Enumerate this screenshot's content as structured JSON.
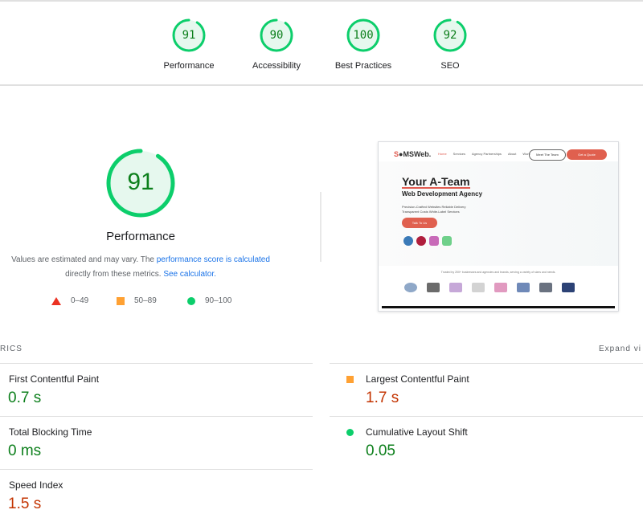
{
  "summary_gauges": [
    {
      "label": "Performance",
      "score": 91,
      "status": "pass"
    },
    {
      "label": "Accessibility",
      "score": 90,
      "status": "pass"
    },
    {
      "label": "Best Practices",
      "score": 100,
      "status": "pass"
    },
    {
      "label": "SEO",
      "score": 92,
      "status": "pass"
    }
  ],
  "performance": {
    "score": 91,
    "title": "Performance",
    "desc_prefix": "Values are estimated and may vary. The ",
    "desc_link1": "performance score is calculated",
    "desc_middle": " directly from these metrics. ",
    "desc_link2": "See calculator."
  },
  "legend": [
    {
      "shape": "triangle",
      "range": "0–49",
      "color": "#eb3223"
    },
    {
      "shape": "square",
      "range": "50–89",
      "color": "#ffa133"
    },
    {
      "shape": "circle",
      "range": "90–100",
      "color": "#0cce6b"
    }
  ],
  "screenshot": {
    "logo_prefix": "S",
    "logo_rest": "MSWeb.",
    "nav_links": [
      "Home",
      "Services",
      "Agency Partnerships",
      "About",
      "Work"
    ],
    "nav_button_outline": "Meet The Team",
    "nav_button_fill": "Get a Quote",
    "headline": "Your A-Team",
    "subheadline": "Web Development Agency",
    "bullets": [
      "Precision-Crafted Websites  Reliable Delivery",
      "Transparent Costs  White-Label Services"
    ],
    "cta": "Talk To Us",
    "trusted_text": "Trusted by 200+ businesses and agencies and brands, serving a variety of sizes and needs."
  },
  "metrics_section": {
    "heading": "RICS",
    "expand_label": "Expand vi"
  },
  "metrics": [
    {
      "name": "First Contentful Paint",
      "value": "0.7 s",
      "rating": "good"
    },
    {
      "name": "Largest Contentful Paint",
      "value": "1.7 s",
      "rating": "average"
    },
    {
      "name": "Total Blocking Time",
      "value": "0 ms",
      "rating": "good"
    },
    {
      "name": "Cumulative Layout Shift",
      "value": "0.05",
      "rating": "good"
    },
    {
      "name": "Speed Index",
      "value": "1.5 s",
      "rating": "average"
    }
  ],
  "colors": {
    "pass": "#0cce6b",
    "pass_text": "#0c7f1b",
    "average": "#ffa133",
    "fail": "#eb3223",
    "average_text": "#c33300",
    "link": "#1a73e8"
  }
}
